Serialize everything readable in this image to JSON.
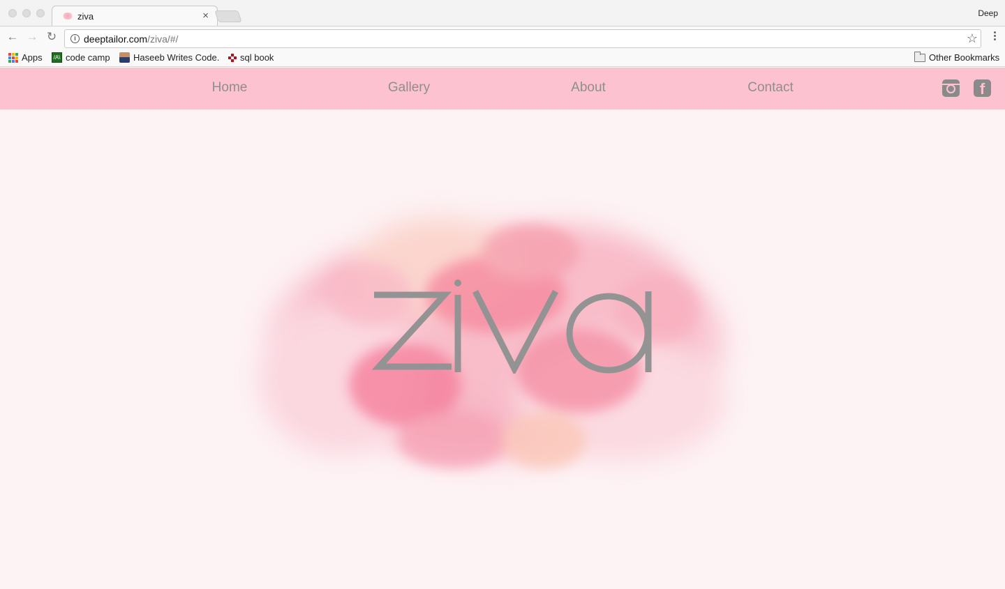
{
  "browser": {
    "tab_title": "ziva",
    "profile_name": "Deep",
    "url_host": "deeptailor.com",
    "url_path": "/ziva/#/",
    "bookmarks": [
      {
        "label": "Apps",
        "icon": "apps-grid-icon"
      },
      {
        "label": "code camp",
        "icon": "code-camp-icon"
      },
      {
        "label": "Haseeb Writes Code.",
        "icon": "avatar-icon"
      },
      {
        "label": "sql book",
        "icon": "sql-book-icon"
      }
    ],
    "other_bookmarks": "Other Bookmarks"
  },
  "site": {
    "nav": [
      {
        "label": "Home"
      },
      {
        "label": "Gallery"
      },
      {
        "label": "About"
      },
      {
        "label": "Contact"
      }
    ],
    "social": [
      {
        "icon": "instagram-icon"
      },
      {
        "icon": "facebook-icon"
      }
    ],
    "logo_text": "ziva"
  },
  "colors": {
    "nav_background": "#fdc2d0",
    "page_background": "#fdf2f4",
    "nav_text": "#8e8e8e",
    "logo_gray": "#939393",
    "splash_pink": "#f5809c"
  }
}
